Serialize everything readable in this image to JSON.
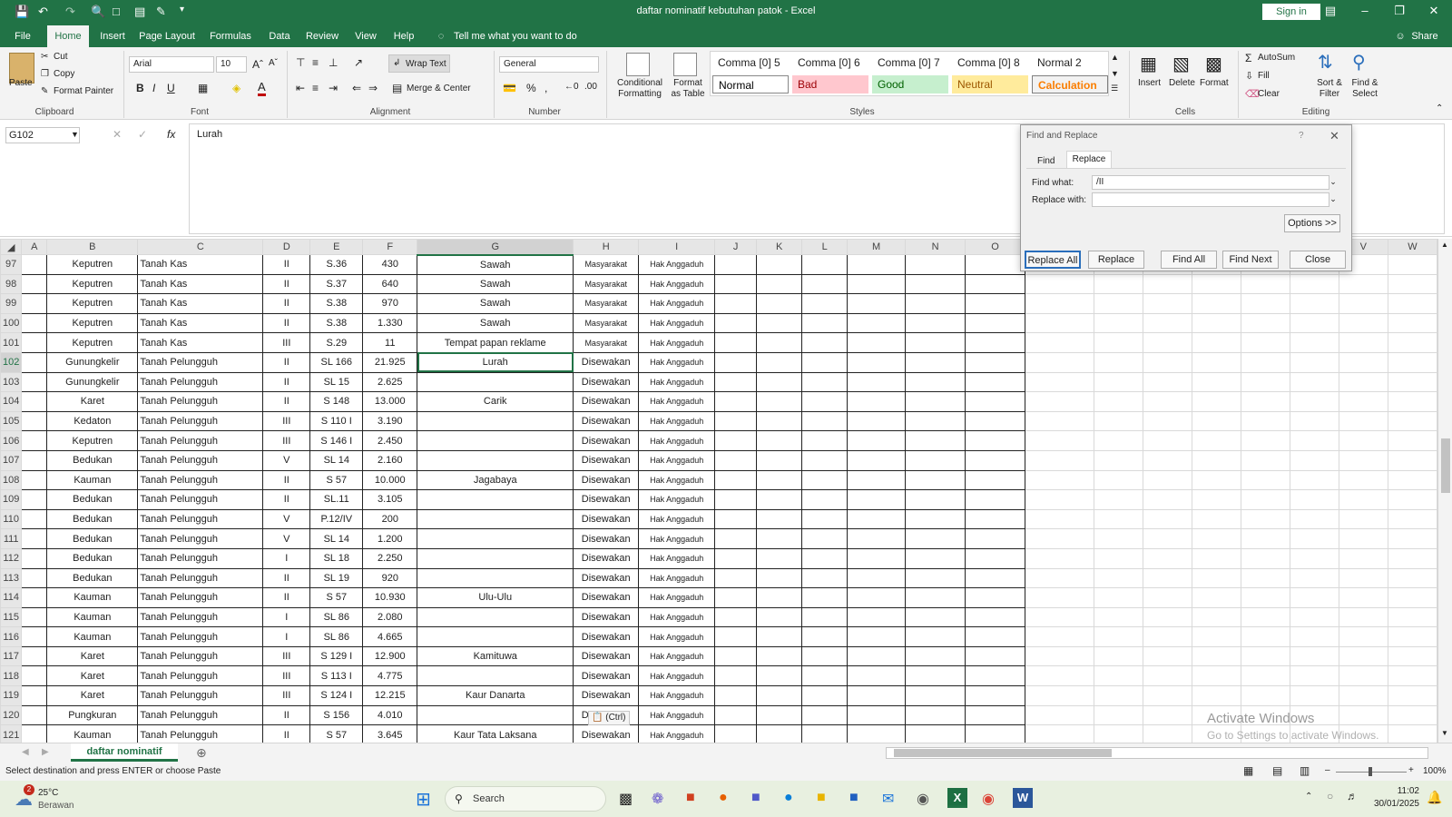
{
  "titlebar": {
    "doc_title": "daftar nominatif kebutuhan patok  -  Excel",
    "sign_in": "Sign in",
    "share": "Share"
  },
  "menu": [
    "File",
    "Home",
    "Insert",
    "Page Layout",
    "Formulas",
    "Data",
    "Review",
    "View",
    "Help"
  ],
  "tell_me": "Tell me what you want to do",
  "ribbon": {
    "paste": "Paste",
    "cut": "Cut",
    "copy": "Copy",
    "format_painter": "Format Painter",
    "clipboard": "Clipboard",
    "font_name": "Arial",
    "font_size": "10",
    "font": "Font",
    "wrap_text": "Wrap Text",
    "merge_center": "Merge & Center",
    "alignment": "Alignment",
    "number_format": "General",
    "number": "Number",
    "conditional_formatting": "Conditional Formatting",
    "format_as_table": "Format as Table",
    "styles": "Styles",
    "style_row1": [
      "Comma [0] 5",
      "Comma [0] 6",
      "Comma [0] 7",
      "Comma [0] 8",
      "Normal 2"
    ],
    "style_row2": [
      {
        "label": "Normal",
        "bg": "#ffffff",
        "fg": "#000000"
      },
      {
        "label": "Bad",
        "bg": "#ffc7ce",
        "fg": "#9c0006"
      },
      {
        "label": "Good",
        "bg": "#c6efce",
        "fg": "#006100"
      },
      {
        "label": "Neutral",
        "bg": "#ffeb9c",
        "fg": "#9c5700"
      },
      {
        "label": "Calculation",
        "bg": "#f2f2f2",
        "fg": "#fa7d00"
      }
    ],
    "insert": "Insert",
    "delete": "Delete",
    "format": "Format",
    "cells": "Cells",
    "autosum": "AutoSum",
    "fill": "Fill",
    "clear": "Clear",
    "sort_filter": "Sort & Filter",
    "find_select": "Find & Select",
    "editing": "Editing"
  },
  "formula_bar": {
    "name_box": "G102",
    "fx": "fx",
    "content": "Lurah"
  },
  "columns": [
    "A",
    "B",
    "C",
    "D",
    "E",
    "F",
    "G",
    "H",
    "I",
    "J",
    "K",
    "L",
    "M",
    "N",
    "O",
    "P",
    "Q",
    "R",
    "S",
    "T",
    "U",
    "V",
    "W"
  ],
  "rows": [
    {
      "n": "97",
      "b": "Keputren",
      "c": "Tanah Kas",
      "d": "II",
      "e": "S.36",
      "f": "430",
      "g": "Sawah",
      "h": "Masyarakat",
      "i": "Hak Anggaduh"
    },
    {
      "n": "98",
      "b": "Keputren",
      "c": "Tanah Kas",
      "d": "II",
      "e": "S.37",
      "f": "640",
      "g": "Sawah",
      "h": "Masyarakat",
      "i": "Hak Anggaduh"
    },
    {
      "n": "99",
      "b": "Keputren",
      "c": "Tanah Kas",
      "d": "II",
      "e": "S.38",
      "f": "970",
      "g": "Sawah",
      "h": "Masyarakat",
      "i": "Hak Anggaduh"
    },
    {
      "n": "100",
      "b": "Keputren",
      "c": "Tanah Kas",
      "d": "II",
      "e": "S.38",
      "f": "1.330",
      "g": "Sawah",
      "h": "Masyarakat",
      "i": "Hak Anggaduh"
    },
    {
      "n": "101",
      "b": "Keputren",
      "c": "Tanah Kas",
      "d": "III",
      "e": "S.29",
      "f": "11",
      "g": "Tempat papan reklame",
      "h": "Masyarakat",
      "i": "Hak Anggaduh"
    },
    {
      "n": "102",
      "b": "Gunungkelir",
      "c": "Tanah Pelungguh",
      "d": "II",
      "e": "SL 166",
      "f": "21.925",
      "g": "Lurah",
      "h": "Disewakan",
      "i": "Hak Anggaduh"
    },
    {
      "n": "103",
      "b": "Gunungkelir",
      "c": "Tanah Pelungguh",
      "d": "II",
      "e": "SL 15",
      "f": "2.625",
      "g": "",
      "h": "Disewakan",
      "i": "Hak Anggaduh"
    },
    {
      "n": "104",
      "b": "Karet",
      "c": "Tanah Pelungguh",
      "d": "II",
      "e": "S 148",
      "f": "13.000",
      "g": "Carik",
      "h": "Disewakan",
      "i": "Hak Anggaduh"
    },
    {
      "n": "105",
      "b": "Kedaton",
      "c": "Tanah Pelungguh",
      "d": "III",
      "e": "S 110  I",
      "f": "3.190",
      "g": "",
      "h": "Disewakan",
      "i": "Hak Anggaduh"
    },
    {
      "n": "106",
      "b": "Keputren",
      "c": "Tanah Pelungguh",
      "d": "III",
      "e": "S 146  I",
      "f": "2.450",
      "g": "",
      "h": "Disewakan",
      "i": "Hak Anggaduh"
    },
    {
      "n": "107",
      "b": "Bedukan",
      "c": "Tanah Pelungguh",
      "d": "V",
      "e": "SL 14",
      "f": "2.160",
      "g": "",
      "h": "Disewakan",
      "i": "Hak Anggaduh"
    },
    {
      "n": "108",
      "b": "Kauman",
      "c": "Tanah Pelungguh",
      "d": "II",
      "e": "S 57",
      "f": "10.000",
      "g": "Jagabaya",
      "h": "Disewakan",
      "i": "Hak Anggaduh"
    },
    {
      "n": "109",
      "b": "Bedukan",
      "c": "Tanah Pelungguh",
      "d": "II",
      "e": "SL.11",
      "f": "3.105",
      "g": "",
      "h": "Disewakan",
      "i": "Hak Anggaduh"
    },
    {
      "n": "110",
      "b": "Bedukan",
      "c": "Tanah Pelungguh",
      "d": "V",
      "e": "P.12/IV",
      "f": "200",
      "g": "",
      "h": "Disewakan",
      "i": "Hak Anggaduh"
    },
    {
      "n": "111",
      "b": "Bedukan",
      "c": "Tanah Pelungguh",
      "d": "V",
      "e": "SL 14",
      "f": "1.200",
      "g": "",
      "h": "Disewakan",
      "i": "Hak Anggaduh"
    },
    {
      "n": "112",
      "b": "Bedukan",
      "c": "Tanah Pelungguh",
      "d": "I",
      "e": "SL 18",
      "f": "2.250",
      "g": "",
      "h": "Disewakan",
      "i": "Hak Anggaduh"
    },
    {
      "n": "113",
      "b": "Bedukan",
      "c": "Tanah Pelungguh",
      "d": "II",
      "e": "SL 19",
      "f": "920",
      "g": "",
      "h": "Disewakan",
      "i": "Hak Anggaduh"
    },
    {
      "n": "114",
      "b": "Kauman",
      "c": "Tanah Pelungguh",
      "d": "II",
      "e": "S 57",
      "f": "10.930",
      "g": "Ulu-Ulu",
      "h": "Disewakan",
      "i": "Hak Anggaduh"
    },
    {
      "n": "115",
      "b": "Kauman",
      "c": "Tanah Pelungguh",
      "d": "I",
      "e": "SL 86",
      "f": "2.080",
      "g": "",
      "h": "Disewakan",
      "i": "Hak Anggaduh"
    },
    {
      "n": "116",
      "b": "Kauman",
      "c": "Tanah Pelungguh",
      "d": "I",
      "e": "SL 86",
      "f": "4.665",
      "g": "",
      "h": "Disewakan",
      "i": "Hak Anggaduh"
    },
    {
      "n": "117",
      "b": "Karet",
      "c": "Tanah Pelungguh",
      "d": "III",
      "e": "S 129  I",
      "f": "12.900",
      "g": "Kamituwa",
      "h": "Disewakan",
      "i": "Hak Anggaduh"
    },
    {
      "n": "118",
      "b": "Karet",
      "c": "Tanah Pelungguh",
      "d": "III",
      "e": "S 113  I",
      "f": "4.775",
      "g": "",
      "h": "Disewakan",
      "i": "Hak Anggaduh"
    },
    {
      "n": "119",
      "b": "Karet",
      "c": "Tanah Pelungguh",
      "d": "III",
      "e": "S 124  I",
      "f": "12.215",
      "g": "Kaur Danarta",
      "h": "Disewakan",
      "i": "Hak Anggaduh"
    },
    {
      "n": "120",
      "b": "Pungkuran",
      "c": "Tanah Pelungguh",
      "d": "II",
      "e": "S 156",
      "f": "4.010",
      "g": "",
      "h": "Disewakan",
      "i": "Hak Anggaduh"
    },
    {
      "n": "121",
      "b": "Kauman",
      "c": "Tanah Pelungguh",
      "d": "II",
      "e": "S 57",
      "f": "3.645",
      "g": "Kaur Tata Laksana",
      "h": "Disewakan",
      "i": "Hak Anggaduh"
    }
  ],
  "paste_options": "(Ctrl)",
  "dialog": {
    "title": "Find and Replace",
    "help": "?",
    "tab_find": "Find",
    "tab_replace": "Replace",
    "find_what_label": "Find what:",
    "find_what_value": "/II",
    "replace_with_label": "Replace with:",
    "replace_with_value": "",
    "options": "Options >>",
    "replace_all": "Replace All",
    "replace": "Replace",
    "find_all": "Find All",
    "find_next": "Find Next",
    "close": "Close"
  },
  "sheet_tab": "daftar nominatif",
  "status_text": "Select destination and press ENTER or choose Paste",
  "zoom": "100%",
  "watermark": {
    "line1": "Activate Windows",
    "line2": "Go to Settings to activate Windows."
  },
  "taskbar": {
    "weather_badge": "2",
    "temperature": "25°C",
    "weather": "Berawan",
    "search": "Search",
    "time": "11:02",
    "date": "30/01/2025"
  }
}
